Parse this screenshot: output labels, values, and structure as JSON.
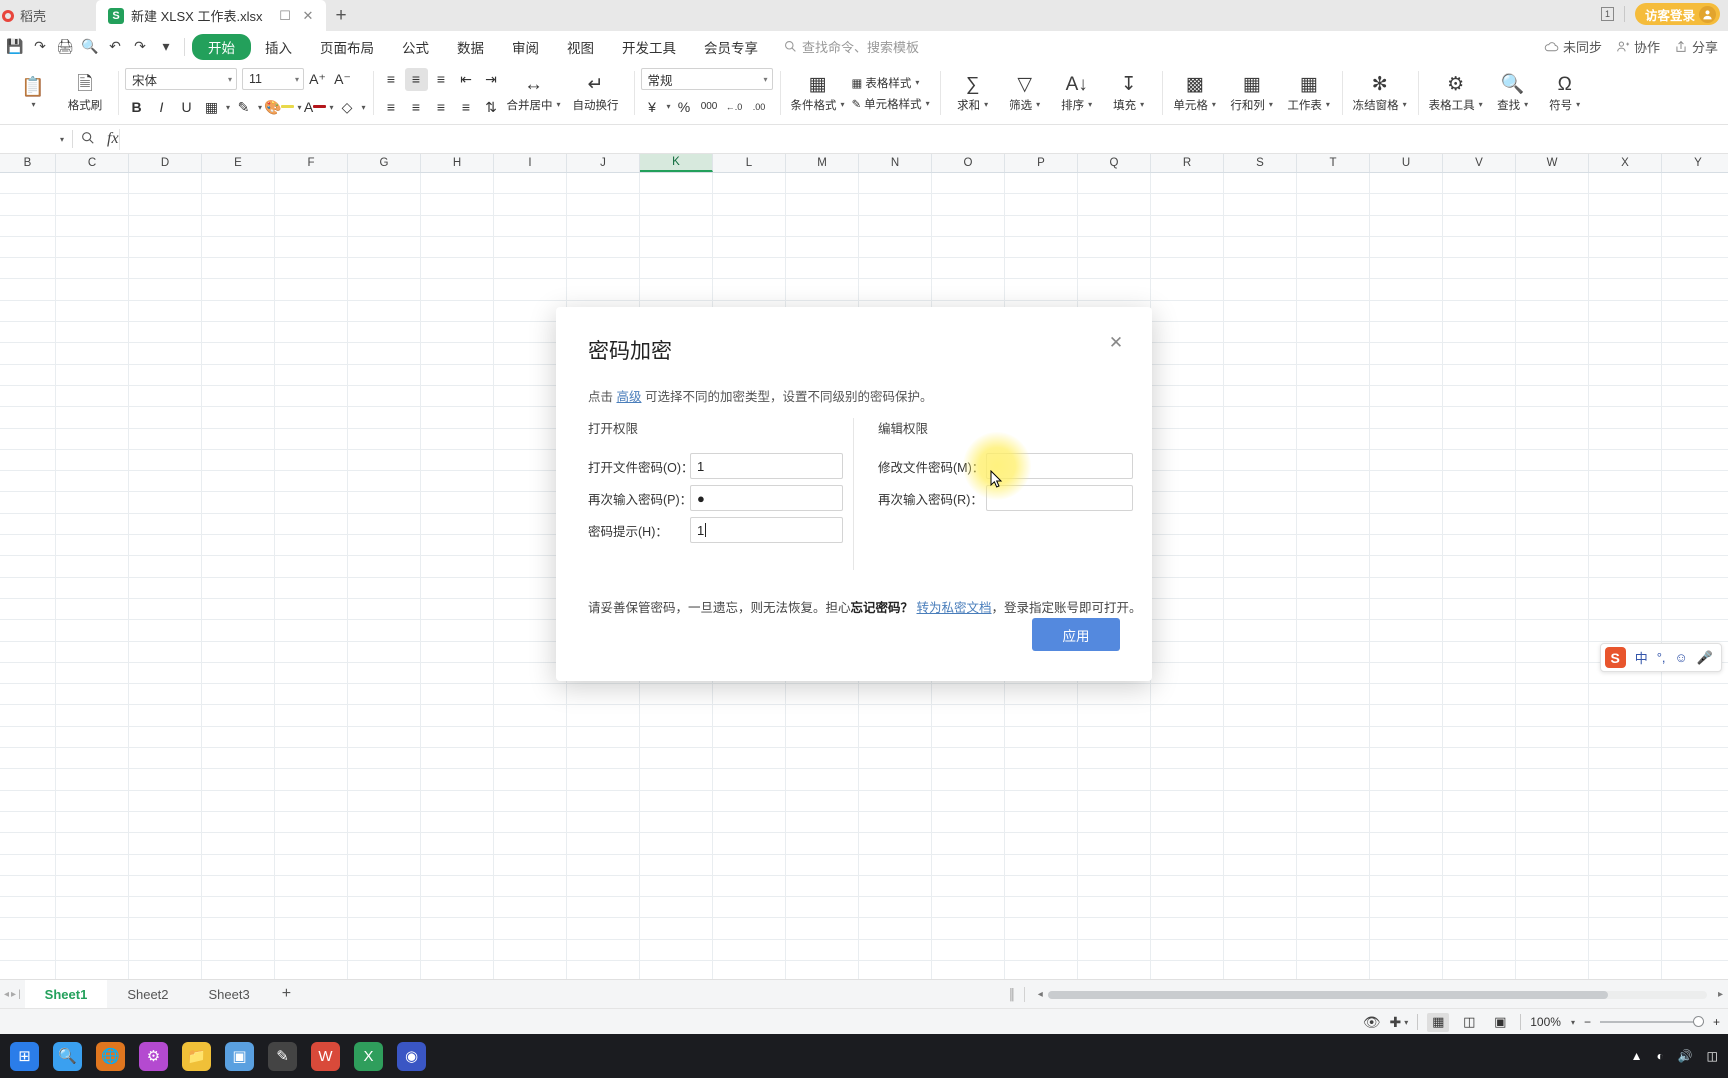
{
  "titlebar": {
    "home_label": "稻壳",
    "tab_title": "新建 XLSX 工作表.xlsx",
    "new_tab": "+",
    "window_count": "1",
    "login_label": "访客登录"
  },
  "menubar": {
    "quick_access": [
      "save-icon",
      "save-as-icon",
      "print-icon",
      "print-preview-icon",
      "undo-icon",
      "redo-icon",
      "more-icon"
    ],
    "items": [
      {
        "label": "开始",
        "active": true
      },
      {
        "label": "插入",
        "active": false
      },
      {
        "label": "页面布局",
        "active": false
      },
      {
        "label": "公式",
        "active": false
      },
      {
        "label": "数据",
        "active": false
      },
      {
        "label": "审阅",
        "active": false
      },
      {
        "label": "视图",
        "active": false
      },
      {
        "label": "开发工具",
        "active": false
      },
      {
        "label": "会员专享",
        "active": false
      }
    ],
    "search_placeholder": "查找命令、搜索模板",
    "sync_label": "未同步",
    "collab_label": "协作",
    "share_label": "分享"
  },
  "ribbon": {
    "format_painter": "格式刷",
    "font_name": "宋体",
    "font_size": "11",
    "merge_center": "合并居中",
    "wrap_text": "自动换行",
    "number_format": "常规",
    "conditional_format": "条件格式",
    "table_style": "表格样式",
    "cell_style": "单元格样式",
    "sum": "求和",
    "filter": "筛选",
    "sort": "排序",
    "fill": "填充",
    "cell": "单元格",
    "rows_cols": "行和列",
    "worksheet": "工作表",
    "freeze_panes": "冻结窗格",
    "table_tools": "表格工具",
    "find": "查找",
    "symbol": "符号"
  },
  "formulabar": {
    "name_box": "",
    "fx_label": "fx",
    "value": ""
  },
  "grid": {
    "columns": [
      "B",
      "C",
      "D",
      "E",
      "F",
      "G",
      "H",
      "I",
      "J",
      "K",
      "L",
      "M",
      "N",
      "O",
      "P",
      "Q",
      "R",
      "S",
      "T",
      "U",
      "V",
      "W",
      "X",
      "Y"
    ],
    "selected_column": "K",
    "row_count": 38
  },
  "ime": {
    "app": "S",
    "mode": "中",
    "punct": "°,",
    "emoji": "☺",
    "voice": "mic-icon"
  },
  "sheetbar": {
    "tabs": [
      {
        "label": "Sheet1",
        "active": true
      },
      {
        "label": "Sheet2",
        "active": false
      },
      {
        "label": "Sheet3",
        "active": false
      }
    ],
    "add_label": "+"
  },
  "statusbar": {
    "zoom_label": "100%",
    "minus": "−",
    "plus": "+"
  },
  "dialog": {
    "title": "密码加密",
    "close": "✕",
    "sub_prefix": "点击 ",
    "sub_link": "高级",
    "sub_suffix": " 可选择不同的加密类型，设置不同级别的密码保护。",
    "left_section": "打开权限",
    "right_section": "编辑权限",
    "fields_left": [
      {
        "label": "打开文件密码(O)：",
        "value": "1",
        "caret": false
      },
      {
        "label": "再次输入密码(P)：",
        "value": "●",
        "caret": false
      },
      {
        "label": "密码提示(H)：",
        "value": "1",
        "caret": true
      }
    ],
    "fields_right": [
      {
        "label": "修改文件密码(M)：",
        "value": "",
        "caret": false
      },
      {
        "label": "再次输入密码(R)：",
        "value": "",
        "caret": false
      }
    ],
    "note_1": "请妥善保管密码，一旦遗忘，则无法恢复。担心",
    "note_bold": "忘记密码？",
    "note_link": "转为私密文档",
    "note_2": "，登录指定账号即可打开。",
    "apply_label": "应用",
    "accent_color": "#5489de"
  }
}
